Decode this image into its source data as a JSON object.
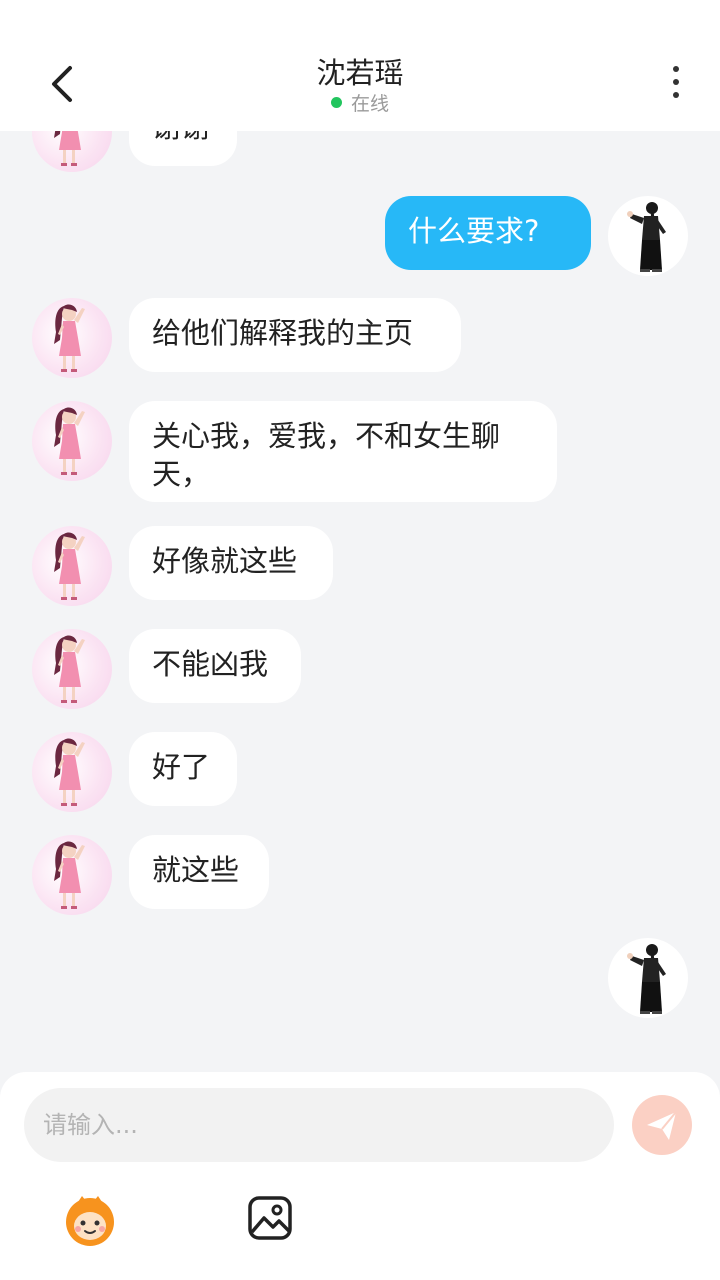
{
  "header": {
    "contact_name": "沈若瑶",
    "status_text": "在线",
    "status_color": "#22c55e",
    "back_icon": "chevron-left-icon",
    "more_icon": "more-vertical-icon"
  },
  "messages": [
    {
      "from": "her",
      "text": "谢谢"
    },
    {
      "from": "me",
      "text": "什么要求?"
    },
    {
      "from": "her",
      "text": "给他们解释我的主页"
    },
    {
      "from": "her",
      "text": "关心我，爱我，不和女生聊天，"
    },
    {
      "from": "her",
      "text": "好像就这些"
    },
    {
      "from": "her",
      "text": "不能凶我"
    },
    {
      "from": "her",
      "text": "好了"
    },
    {
      "from": "her",
      "text": "就这些"
    },
    {
      "from": "me",
      "text": ""
    }
  ],
  "composer": {
    "placeholder": "请输入...",
    "send_icon": "paper-plane-icon",
    "emoji_icon": "cartoon-face-icon",
    "image_icon": "image-icon"
  },
  "colors": {
    "my_bubble": "#27b8f7",
    "her_bubble": "#ffffff",
    "background": "#f3f4f6",
    "send_button": "#fbd0c4"
  }
}
